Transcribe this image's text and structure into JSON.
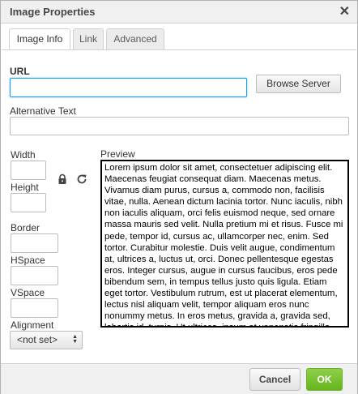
{
  "dialog": {
    "title": "Image Properties",
    "close_glyph": "✕"
  },
  "tabs": [
    {
      "label": "Image Info",
      "active": true
    },
    {
      "label": "Link",
      "active": false
    },
    {
      "label": "Advanced",
      "active": false
    }
  ],
  "url": {
    "label": "URL",
    "value": "",
    "browse_button": "Browse Server"
  },
  "alt_text": {
    "label": "Alternative Text",
    "value": ""
  },
  "dimensions": {
    "width_label": "Width",
    "width_value": "",
    "height_label": "Height",
    "height_value": "",
    "lock_icon": "lock-icon",
    "reset_icon": "reset-size-icon"
  },
  "spacing": {
    "border_label": "Border",
    "border_value": "",
    "hspace_label": "HSpace",
    "hspace_value": "",
    "vspace_label": "VSpace",
    "vspace_value": ""
  },
  "alignment": {
    "label": "Alignment",
    "selected": "<not set>"
  },
  "preview": {
    "label": "Preview",
    "text": "Lorem ipsum dolor sit amet, consectetuer adipiscing elit. Maecenas feugiat consequat diam. Maecenas metus. Vivamus diam purus, cursus a, commodo non, facilisis vitae, nulla. Aenean dictum lacinia tortor. Nunc iaculis, nibh non iaculis aliquam, orci felis euismod neque, sed ornare massa mauris sed velit. Nulla pretium mi et risus. Fusce mi pede, tempor id, cursus ac, ullamcorper nec, enim. Sed tortor. Curabitur molestie. Duis velit augue, condimentum at, ultrices a, luctus ut, orci. Donec pellentesque egestas eros. Integer cursus, augue in cursus faucibus, eros pede bibendum sem, in tempus tellus justo quis ligula. Etiam eget tortor. Vestibulum rutrum, est ut placerat elementum, lectus nisl aliquam velit, tempor aliquam eros nunc nonummy metus. In eros metus, gravida a, gravida sed, lobortis id, turpis. Ut ultrices, ipsum at venenatis fringilla, sem nulla lacinia tellus, eget aliquet turpis mauris non enim."
  },
  "footer": {
    "cancel": "Cancel",
    "ok": "OK"
  },
  "colors": {
    "ok_green": "#7ac142",
    "focus_blue": "#139ff7"
  }
}
